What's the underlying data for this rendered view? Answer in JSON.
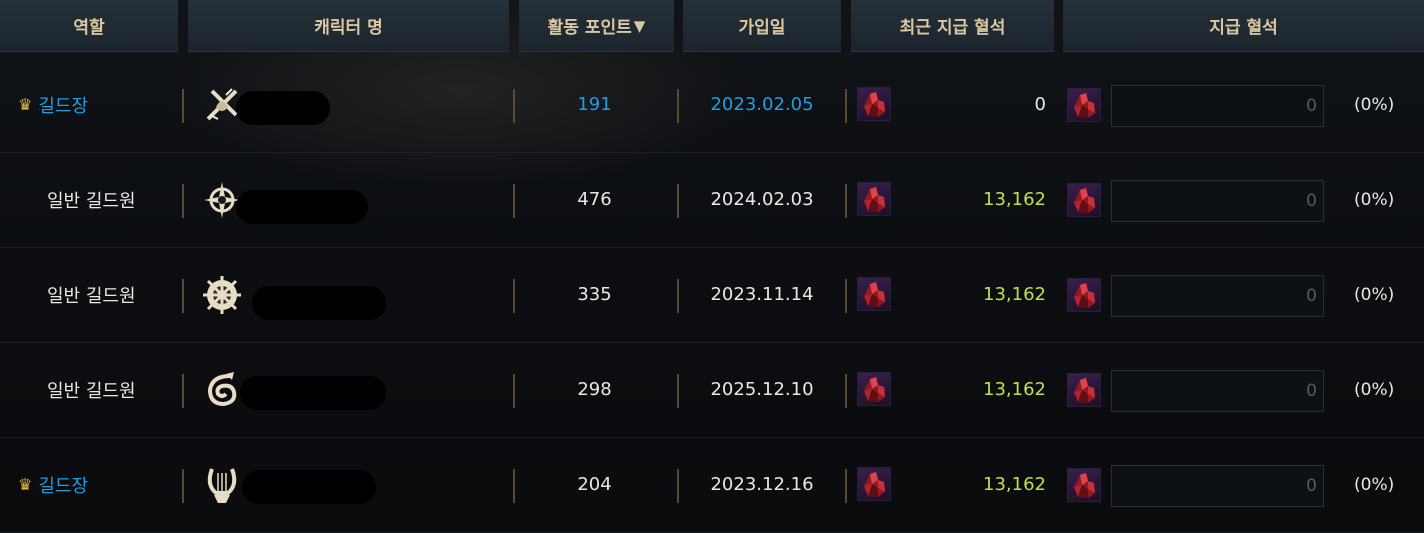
{
  "headers": {
    "role": "역할",
    "character": "캐릭터 명",
    "activity": "활동 포인트",
    "sort_arrow": "▼",
    "joined": "가입일",
    "recent": "최근 지급 혈석",
    "payment": "지급 혈석"
  },
  "rows": [
    {
      "role": "길드장",
      "crown": true,
      "icon": "crossed-swords-emblem-icon",
      "points": "191",
      "joined": "2023.02.05",
      "recent": "0",
      "amount": "0",
      "percent": "(0%)"
    },
    {
      "role": "일반 길드원",
      "crown": false,
      "icon": "compass-star-emblem-icon",
      "points": "476",
      "joined": "2024.02.03",
      "recent": "13,162",
      "amount": "0",
      "percent": "(0%)"
    },
    {
      "role": "일반 길드원",
      "crown": false,
      "icon": "sun-wheel-emblem-icon",
      "points": "335",
      "joined": "2023.11.14",
      "recent": "13,162",
      "amount": "0",
      "percent": "(0%)"
    },
    {
      "role": "일반 길드원",
      "crown": false,
      "icon": "dragon-emblem-icon",
      "points": "298",
      "joined": "2025.12.10",
      "recent": "13,162",
      "amount": "0",
      "percent": "(0%)"
    },
    {
      "role": "길드장",
      "crown": true,
      "icon": "lyre-emblem-icon",
      "points": "204",
      "joined": "2023.12.16",
      "recent": "13,162",
      "amount": "0",
      "percent": "(0%)"
    }
  ],
  "colors": {
    "header_text": "#dcc9a3",
    "leader_text": "#1f9ee3",
    "recent_highlight": "#c7dc4e",
    "crown": "#e9b93a"
  },
  "resource_icon": "bloodstone-icon",
  "crown_icon": "crown-icon"
}
